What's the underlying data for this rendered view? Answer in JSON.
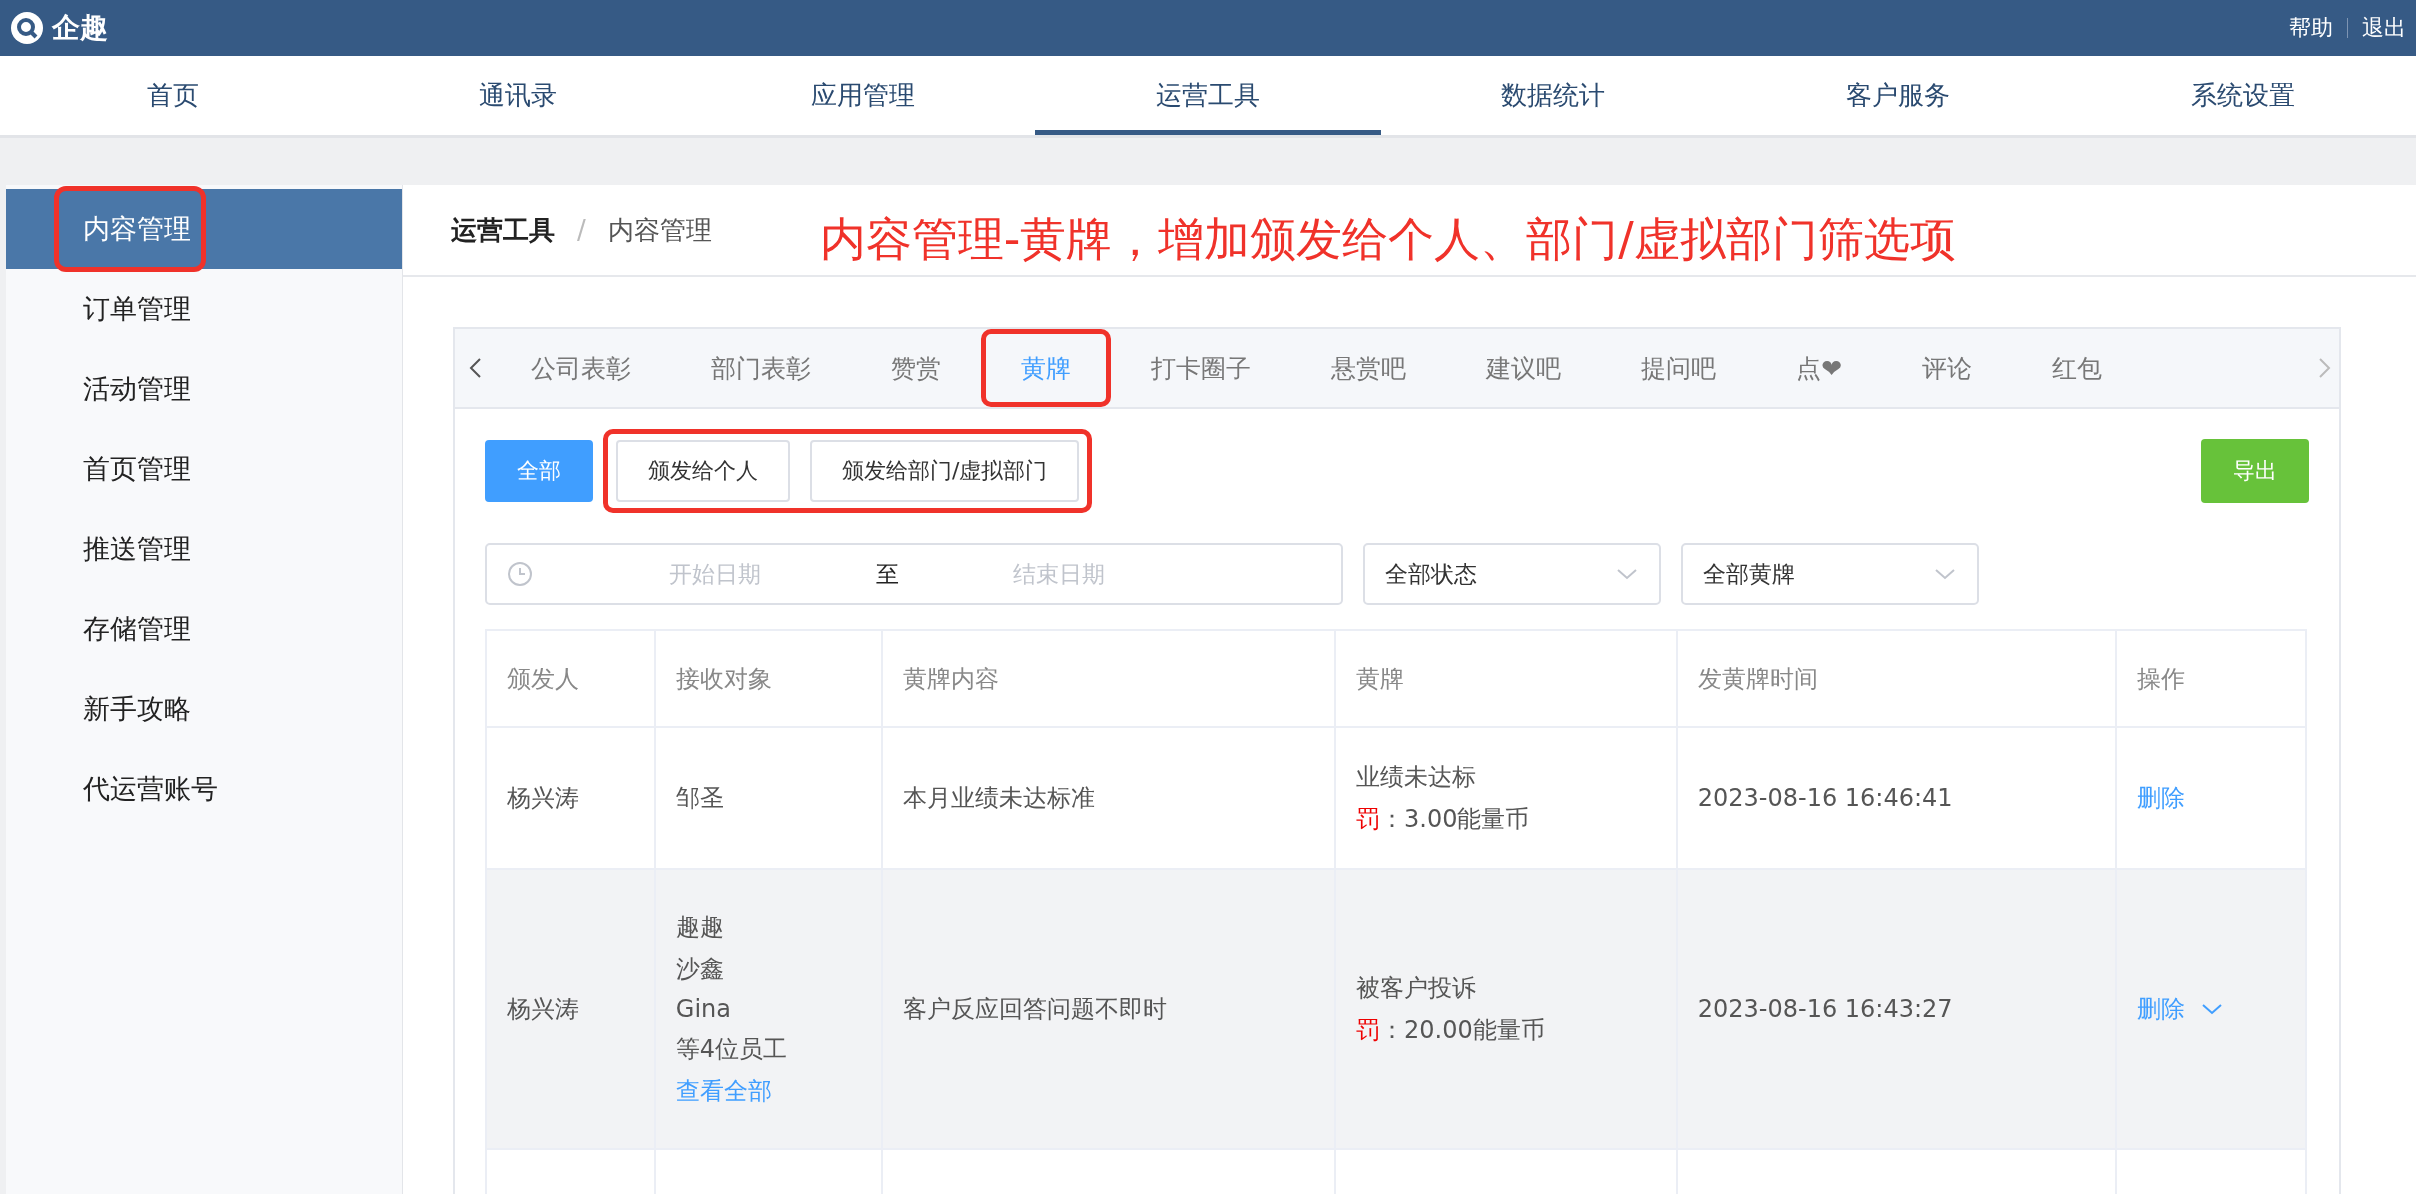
{
  "header": {
    "brand": "企趣",
    "links": [
      "帮助",
      "退出"
    ]
  },
  "nav": [
    {
      "label": "首页",
      "selected": false
    },
    {
      "label": "通讯录",
      "selected": false
    },
    {
      "label": "应用管理",
      "selected": false
    },
    {
      "label": "运营工具",
      "selected": true
    },
    {
      "label": "数据统计",
      "selected": false
    },
    {
      "label": "客户服务",
      "selected": false
    },
    {
      "label": "系统设置",
      "selected": false
    }
  ],
  "sidebar": {
    "items": [
      {
        "label": "内容管理",
        "selected": true,
        "highlighted": true
      },
      {
        "label": "订单管理",
        "selected": false,
        "highlighted": false
      },
      {
        "label": "活动管理",
        "selected": false,
        "highlighted": false
      },
      {
        "label": "首页管理",
        "selected": false,
        "highlighted": false
      },
      {
        "label": "推送管理",
        "selected": false,
        "highlighted": false
      },
      {
        "label": "存储管理",
        "selected": false,
        "highlighted": false
      },
      {
        "label": "新手攻略",
        "selected": false,
        "highlighted": false
      },
      {
        "label": "代运营账号",
        "selected": false,
        "highlighted": false
      }
    ]
  },
  "breadcrumb": [
    "运营工具",
    "内容管理"
  ],
  "breadcrumb_separator": "/",
  "annotation": "内容管理-黄牌，增加颁发给个人、部门/虚拟部门筛选项",
  "tabs": [
    {
      "label": "公司表彰",
      "selected": false,
      "highlighted": false
    },
    {
      "label": "部门表彰",
      "selected": false,
      "highlighted": false
    },
    {
      "label": "赞赏",
      "selected": false,
      "highlighted": false
    },
    {
      "label": "黄牌",
      "selected": true,
      "highlighted": true
    },
    {
      "label": "打卡圈子",
      "selected": false,
      "highlighted": false
    },
    {
      "label": "悬赏吧",
      "selected": false,
      "highlighted": false
    },
    {
      "label": "建议吧",
      "selected": false,
      "highlighted": false
    },
    {
      "label": "提问吧",
      "selected": false,
      "highlighted": false
    },
    {
      "label": "点❤",
      "selected": false,
      "highlighted": false
    },
    {
      "label": "评论",
      "selected": false,
      "highlighted": false
    },
    {
      "label": "红包",
      "selected": false,
      "highlighted": false
    }
  ],
  "filters": {
    "buttons": [
      {
        "label": "全部",
        "selected": true,
        "highlighted": false
      },
      {
        "label": "颁发给个人",
        "selected": false,
        "highlighted": true
      },
      {
        "label": "颁发给部门/虚拟部门",
        "selected": false,
        "highlighted": true
      }
    ],
    "export": "导出",
    "date_range": {
      "start_placeholder": "开始日期",
      "separator": "至",
      "end_placeholder": "结束日期"
    },
    "selects": [
      {
        "value": "全部状态"
      },
      {
        "value": "全部黄牌"
      }
    ]
  },
  "table": {
    "columns": [
      "颁发人",
      "接收对象",
      "黄牌内容",
      "黄牌",
      "发黄牌时间",
      "操作"
    ],
    "rows": [
      {
        "issuer": "杨兴涛",
        "recipients": [
          "邹圣"
        ],
        "view_all": null,
        "content": "本月业绩未达标准",
        "card": "业绩未达标",
        "penalty_label": "罚",
        "penalty_value": "：3.00能量币",
        "time": "2023-08-16 16:46:41",
        "action": "删除",
        "action_menu": false,
        "hovered": false
      },
      {
        "issuer": "杨兴涛",
        "recipients": [
          "趣趣",
          "沙鑫",
          "Gina",
          "等4位员工"
        ],
        "view_all": "查看全部",
        "content": "客户反应回答问题不即时",
        "card": "被客户投诉",
        "penalty_label": "罚",
        "penalty_value": "：20.00能量币",
        "time": "2023-08-16 16:43:27",
        "action": "删除",
        "action_menu": true,
        "hovered": true
      }
    ]
  }
}
